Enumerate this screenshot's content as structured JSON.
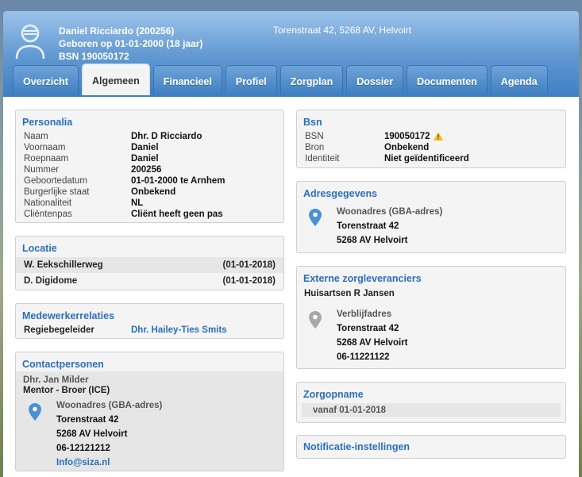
{
  "header": {
    "name_line": "Daniel Ricciardo (200256)",
    "birth_line": "Geboren op 01-01-2000 (18 jaar)",
    "bsn_line": "BSN 190050172",
    "address": "Torenstraat 42, 5268 AV, Helvoirt"
  },
  "tabs": [
    {
      "label": "Overzicht"
    },
    {
      "label": "Algemeen"
    },
    {
      "label": "Financieel"
    },
    {
      "label": "Profiel"
    },
    {
      "label": "Zorgplan"
    },
    {
      "label": "Dossier"
    },
    {
      "label": "Documenten"
    },
    {
      "label": "Agenda"
    }
  ],
  "personalia": {
    "title": "Personalia",
    "rows": [
      {
        "k": "Naam",
        "v": "Dhr. D Ricciardo"
      },
      {
        "k": "Voornaam",
        "v": "Daniel"
      },
      {
        "k": "Roepnaam",
        "v": "Daniel"
      },
      {
        "k": "Nummer",
        "v": "200256"
      },
      {
        "k": "Geboortedatum",
        "v": "01-01-2000 te Arnhem"
      },
      {
        "k": "Burgerlijke staat",
        "v": "Onbekend"
      },
      {
        "k": "Nationaliteit",
        "v": "NL"
      },
      {
        "k": "Cliëntenpas",
        "v": "Cliënt heeft geen pas"
      }
    ]
  },
  "locatie": {
    "title": "Locatie",
    "rows": [
      {
        "name": "W. Eekschillerweg",
        "date": "(01-01-2018)"
      },
      {
        "name": "D. Digidome",
        "date": "(01-01-2018)"
      }
    ]
  },
  "medewerkers": {
    "title": "Medewerkerrelaties",
    "role": "Regiebegeleider",
    "person": "Dhr. Hailey-Ties Smits"
  },
  "contact": {
    "title": "Contactpersonen",
    "name": "Dhr. Jan Milder",
    "relation": "Mentor - Broer (ICE)",
    "addr_label": "Woonadres (GBA-adres)",
    "street": "Torenstraat 42",
    "city": "5268 AV Helvoirt",
    "phone": "06-12121212",
    "email": "Info@siza.nl"
  },
  "bsn": {
    "title": "Bsn",
    "rows": [
      {
        "k": "BSN",
        "v": "190050172"
      },
      {
        "k": "Bron",
        "v": "Onbekend"
      },
      {
        "k": "Identiteit",
        "v": "Niet geïdentificeerd"
      }
    ]
  },
  "adres": {
    "title": "Adresgegevens",
    "label": "Woonadres (GBA-adres)",
    "street": "Torenstraat 42",
    "city": "5268 AV Helvoirt"
  },
  "extern": {
    "title": "Externe zorgleveranciers",
    "provider": "Huisartsen R Jansen",
    "label": "Verblijfadres",
    "street": "Torenstraat 42",
    "city": "5268 AV Helvoirt",
    "phone": "06-11221122"
  },
  "zorgopname": {
    "title": "Zorgopname",
    "value": "vanaf 01-01-2018"
  },
  "notificatie": {
    "title": "Notificatie-instellingen"
  },
  "colors": {
    "accent": "#2a6fbe",
    "pin_blue": "#4a90d9",
    "pin_grey": "#a8a8a8",
    "warning": "#f0c020"
  }
}
